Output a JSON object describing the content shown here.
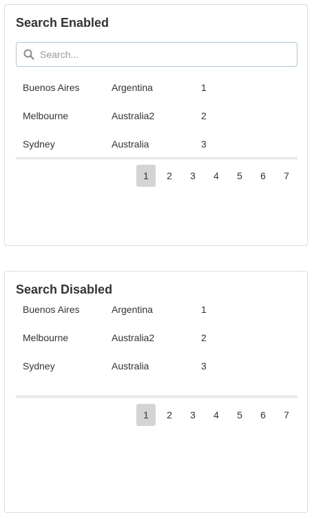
{
  "panels": [
    {
      "title": "Search Enabled",
      "search": {
        "placeholder": "Search..."
      },
      "rows": [
        {
          "city": "Buenos Aires",
          "country": "Argentina",
          "num": "1"
        },
        {
          "city": "Melbourne",
          "country": "Australia2",
          "num": "2"
        },
        {
          "city": "Sydney",
          "country": "Australia",
          "num": "3"
        }
      ],
      "pages": [
        "1",
        "2",
        "3",
        "4",
        "5",
        "6",
        "7"
      ],
      "active_page": "1"
    },
    {
      "title": "Search Disabled",
      "rows": [
        {
          "city": "Buenos Aires",
          "country": "Argentina",
          "num": "1"
        },
        {
          "city": "Melbourne",
          "country": "Australia2",
          "num": "2"
        },
        {
          "city": "Sydney",
          "country": "Australia",
          "num": "3"
        }
      ],
      "pages": [
        "1",
        "2",
        "3",
        "4",
        "5",
        "6",
        "7"
      ],
      "active_page": "1"
    }
  ],
  "icons": {
    "search": "search-icon"
  },
  "colors": {
    "active_page_bg": "#d4d4d4",
    "search_border": "#aac6d8"
  }
}
